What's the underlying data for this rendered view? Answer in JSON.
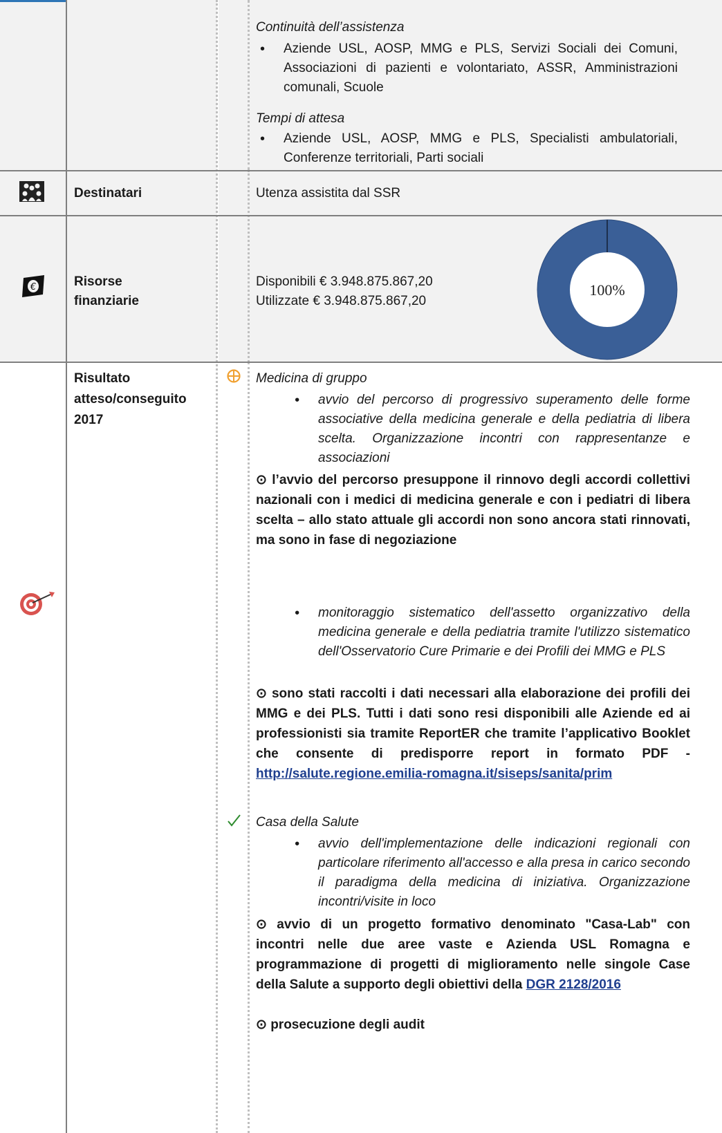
{
  "row1": {
    "continuita_heading": "Continuità dell’assistenza",
    "continuita_item": "Aziende USL, AOSP, MMG e PLS, Servizi Sociali dei Comuni, Associazioni di pazienti e volontariato, ASSR, Amministrazioni comunali, Scuole",
    "tempi_heading": "Tempi di attesa",
    "tempi_item": "Aziende USL, AOSP, MMG e PLS, Specialisti ambulatoriali, Conferenze territoriali, Parti sociali"
  },
  "destinatari": {
    "icon": "people-group-icon",
    "label": "Destinatari",
    "value": "Utenza assistita dal SSR"
  },
  "risorse": {
    "icon": "euro-note-icon",
    "label_line1": "Risorse",
    "label_line2": "finanziarie",
    "disponibili": "Disponibili € 3.948.875.867,20",
    "utilizzate": "Utilizzate € 3.948.875.867,20",
    "percent_label": "100%",
    "percent_value": 100,
    "donut_color": "#3a5f97"
  },
  "risultato": {
    "icon": "target-dart-icon",
    "label_line1": "Risultato",
    "label_line2": "atteso/conseguito",
    "label_line3": "2017",
    "medicina": {
      "status_icon": "in-progress-icon",
      "heading": "Medicina di gruppo",
      "item1": "avvio del percorso di progressivo superamento delle forme associative della medicina generale e della pediatria di libera scelta. Organizzazione incontri con rappresentanze e associazioni",
      "result1": "⊙ l’avvio del percorso presuppone il rinnovo degli accordi collettivi nazionali con i medici di medicina generale e con i pediatri di libera scelta – allo stato attuale gli accordi non sono ancora stati rinnovati, ma sono in fase di negoziazione",
      "item2": "monitoraggio sistematico dell'assetto organizzativo della medicina generale e della pediatria tramite l'utilizzo sistematico dell'Osservatorio Cure Primarie e dei Profili dei MMG e PLS",
      "result2_text": "⊙ sono stati raccolti i dati necessari alla elaborazione dei profili dei MMG e dei PLS. Tutti i dati sono resi disponibili alle Aziende ed ai professionisti sia tramite ReportER che tramite l’applicativo Booklet che consente di predisporre report in formato PDF - ",
      "result2_link": "http://salute.regione.emilia-romagna.it/siseps/sanita/prim"
    },
    "casa": {
      "status_icon": "checkmark-icon",
      "heading": "Casa della Salute",
      "item1": "avvio dell'implementazione delle indicazioni regionali con particolare riferimento all'accesso e alla presa in carico secondo il paradigma della medicina di iniziativa. Organizzazione incontri/visite in loco",
      "result1_text": "⊙ avvio di un progetto formativo denominato \"Casa-Lab\" con incontri nelle due aree vaste e Azienda USL Romagna e programmazione di progetti di miglioramento nelle singole Case della Salute a supporto degli obiettivi della ",
      "result1_link": "DGR 2128/2016",
      "result2": "⊙ prosecuzione degli audit"
    }
  }
}
